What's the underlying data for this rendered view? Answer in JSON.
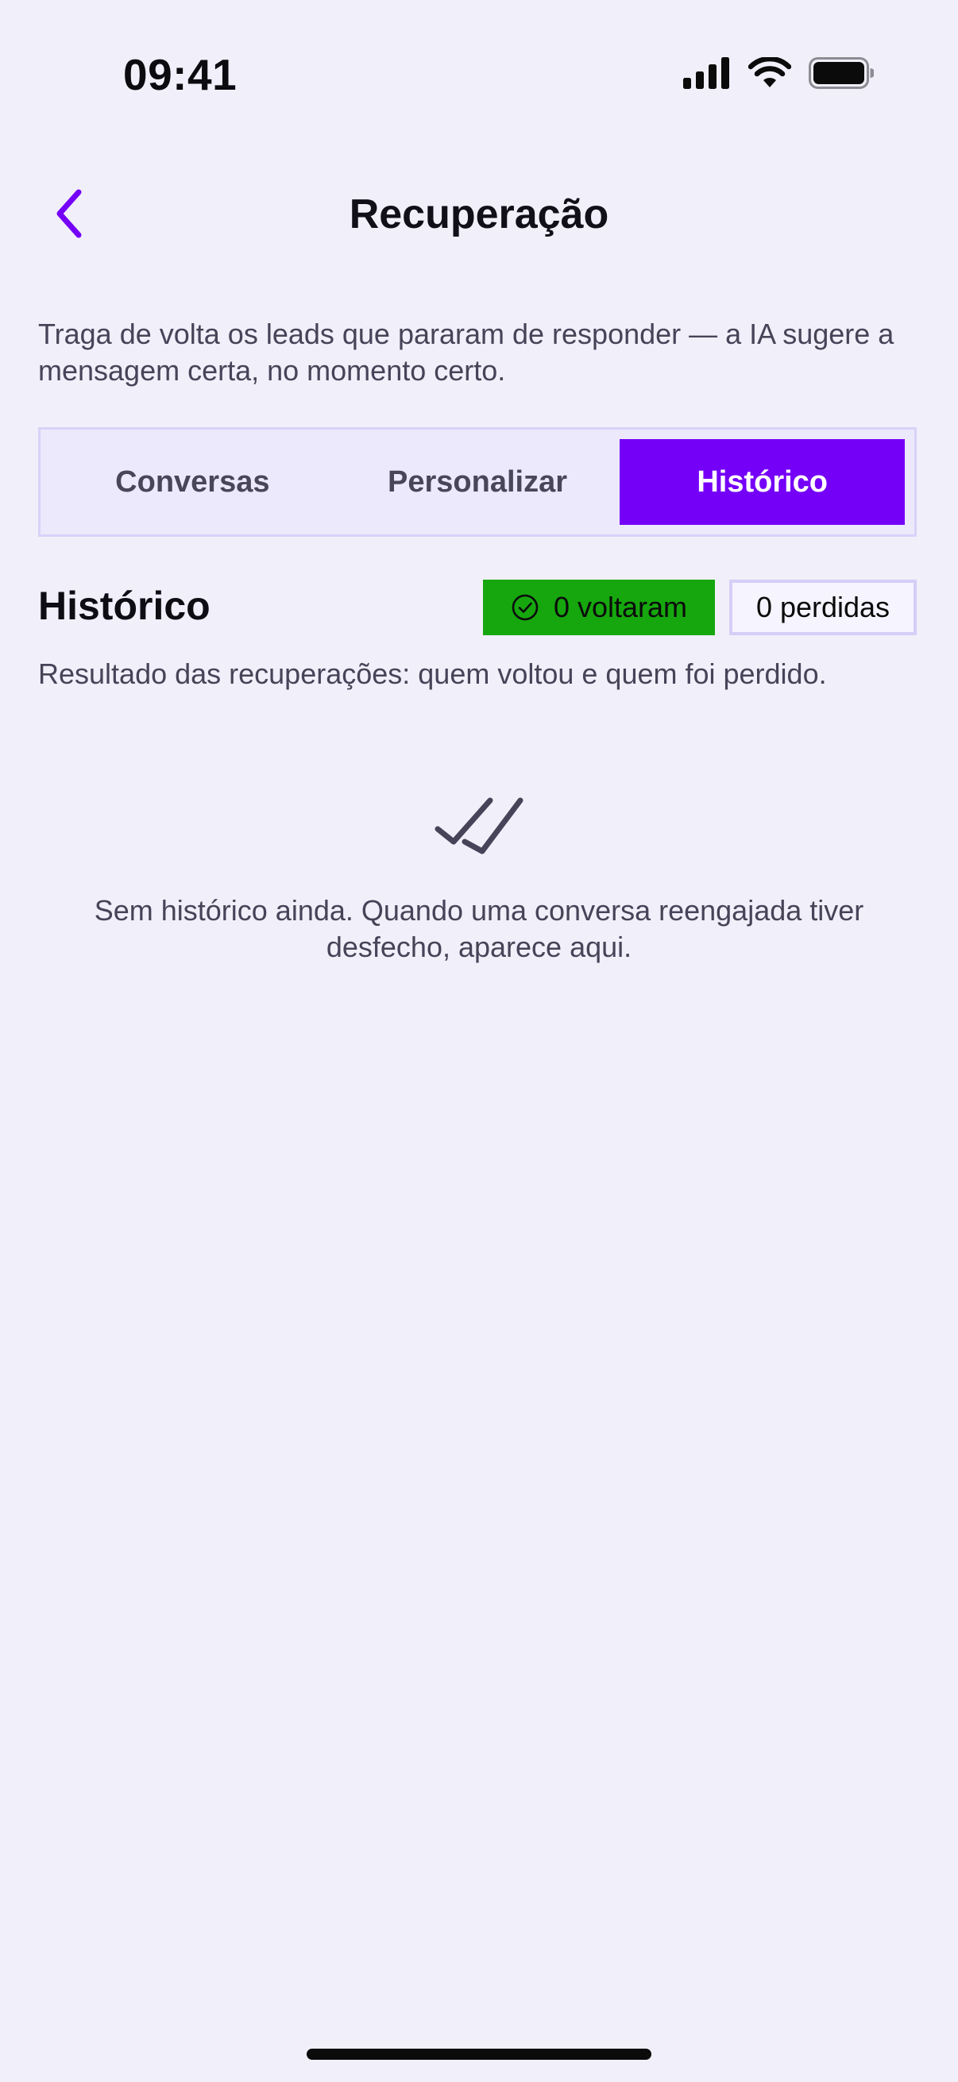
{
  "status_bar": {
    "time": "09:41",
    "icons": [
      "cellular-signal-icon",
      "wifi-icon",
      "battery-icon"
    ]
  },
  "header": {
    "title": "Recuperação",
    "back_icon": "chevron-left-icon"
  },
  "intro": {
    "text": "Traga de volta os leads que pararam de responder — a IA sugere a mensagem certa, no momento certo."
  },
  "tabs": [
    {
      "label": "Conversas",
      "active": false
    },
    {
      "label": "Personalizar",
      "active": false
    },
    {
      "label": "Histórico",
      "active": true
    }
  ],
  "section": {
    "title": "Histórico",
    "returned_badge": "0 voltaram",
    "returned_icon": "check-circle-icon",
    "lost_badge": "0 perdidas",
    "subtitle": "Resultado das recuperações: quem voltou e quem foi perdido."
  },
  "empty_state": {
    "icon": "double-check-icon",
    "text": "Sem histórico ainda. Quando uma conversa reengajada tiver desfecho, aparece aqui."
  },
  "colors": {
    "background": "#F1EFF9",
    "accent": "#7500F7",
    "success": "#16A70E",
    "muted_text": "#474358"
  }
}
